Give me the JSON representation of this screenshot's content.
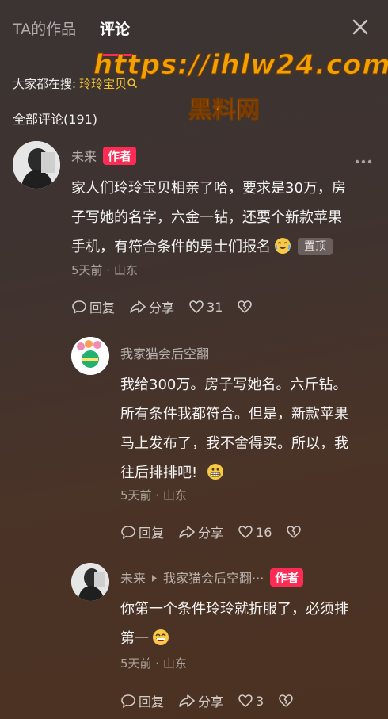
{
  "tabs": {
    "works": "TA的作品",
    "comments": "评论"
  },
  "search": {
    "label": "大家都在搜:",
    "term": "玲玲宝贝"
  },
  "watermark": {
    "url": "https://ihlw24.com",
    "name": "黑料网"
  },
  "comment_count": "全部评论(191)",
  "comments": [
    {
      "author": "未来",
      "author_tag": "作者",
      "text_lines": [
        "家人们玲玲宝贝相亲了哈，要求是30万，房",
        "子写她的名字，六金一钻，还要个新款苹果",
        "手机，有符合条件的男士们报名"
      ],
      "pin": "置顶",
      "meta": "5天前 · 山东",
      "reply": "回复",
      "share": "分享",
      "likes": "31"
    },
    {
      "author": "我家猫会后空翻",
      "text_lines": [
        "我给300万。房子写她名。六斤钻。",
        "所有条件我都符合。但是，新款苹果",
        "马上发布了，我不舍得买。所以，我",
        "往后排排吧!"
      ],
      "meta": "5天前 · 山东",
      "reply": "回复",
      "share": "分享",
      "likes": "16"
    },
    {
      "author": "未来",
      "reply_to": "我家猫会后空翻···",
      "author_tag": "作者",
      "text_lines": [
        "你第一个条件玲玲就折服了，必须排",
        "第一"
      ],
      "meta": "5天前 · 山东",
      "reply": "回复",
      "share": "分享",
      "likes": "3"
    }
  ],
  "colors": {
    "accent": "#fe2c55",
    "search_link": "#f5c030",
    "watermark": "#f2a200"
  }
}
